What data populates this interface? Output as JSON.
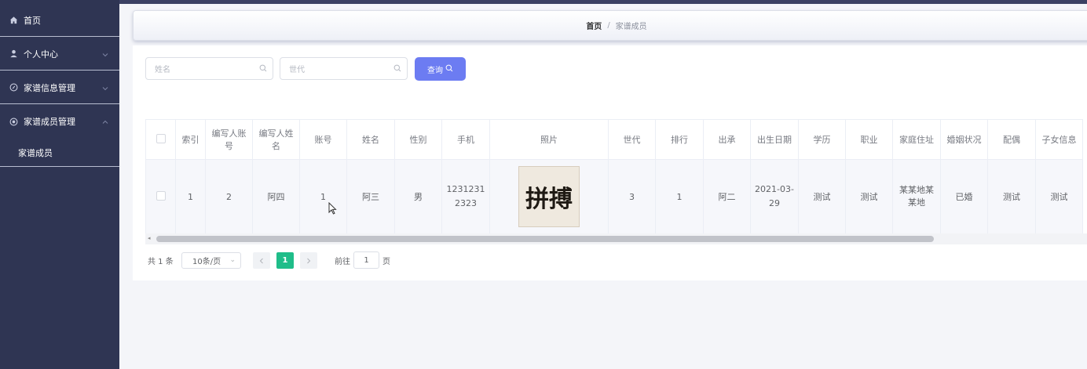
{
  "sidebar": {
    "items": [
      {
        "label": "首页",
        "icon": "home-icon"
      },
      {
        "label": "个人中心",
        "icon": "user-icon"
      },
      {
        "label": "家谱信息管理",
        "icon": "info-circle-icon"
      },
      {
        "label": "家谱成员管理",
        "icon": "members-icon"
      }
    ],
    "sub_items": [
      {
        "label": "家谱成员"
      }
    ]
  },
  "breadcrumb": {
    "home": "首页",
    "separator": "/",
    "current": "家谱成员"
  },
  "search": {
    "name_placeholder": "姓名",
    "generation_placeholder": "世代",
    "query_label": "查询"
  },
  "table": {
    "columns": [
      "索引",
      "编写人账号",
      "编写人姓名",
      "账号",
      "姓名",
      "性别",
      "手机",
      "照片",
      "世代",
      "排行",
      "出承",
      "出生日期",
      "学历",
      "职业",
      "家庭住址",
      "婚姻状况",
      "配偶",
      "子女信息"
    ],
    "rows": [
      {
        "index": "1",
        "writer_account": "2",
        "writer_name": "阿四",
        "account": "1",
        "name": "阿三",
        "gender": "男",
        "phone": "12312312323",
        "photo_text": "拼搏",
        "generation": "3",
        "rank": "1",
        "lineage": "阿二",
        "birth_date": "2021-03-29",
        "education": "测试",
        "occupation": "测试",
        "address": "某某地某某地",
        "marital_status": "已婚",
        "spouse": "测试",
        "children": "测试"
      }
    ]
  },
  "pagination": {
    "total": "共 1 条",
    "page_size": "10条/页",
    "current_page": "1",
    "goto_label": "前往",
    "goto_value": "1",
    "page_label": "页"
  },
  "colors": {
    "sidebar_bg": "#2f3553",
    "primary": "#6c7cf2",
    "page_active": "#1fbd89"
  }
}
